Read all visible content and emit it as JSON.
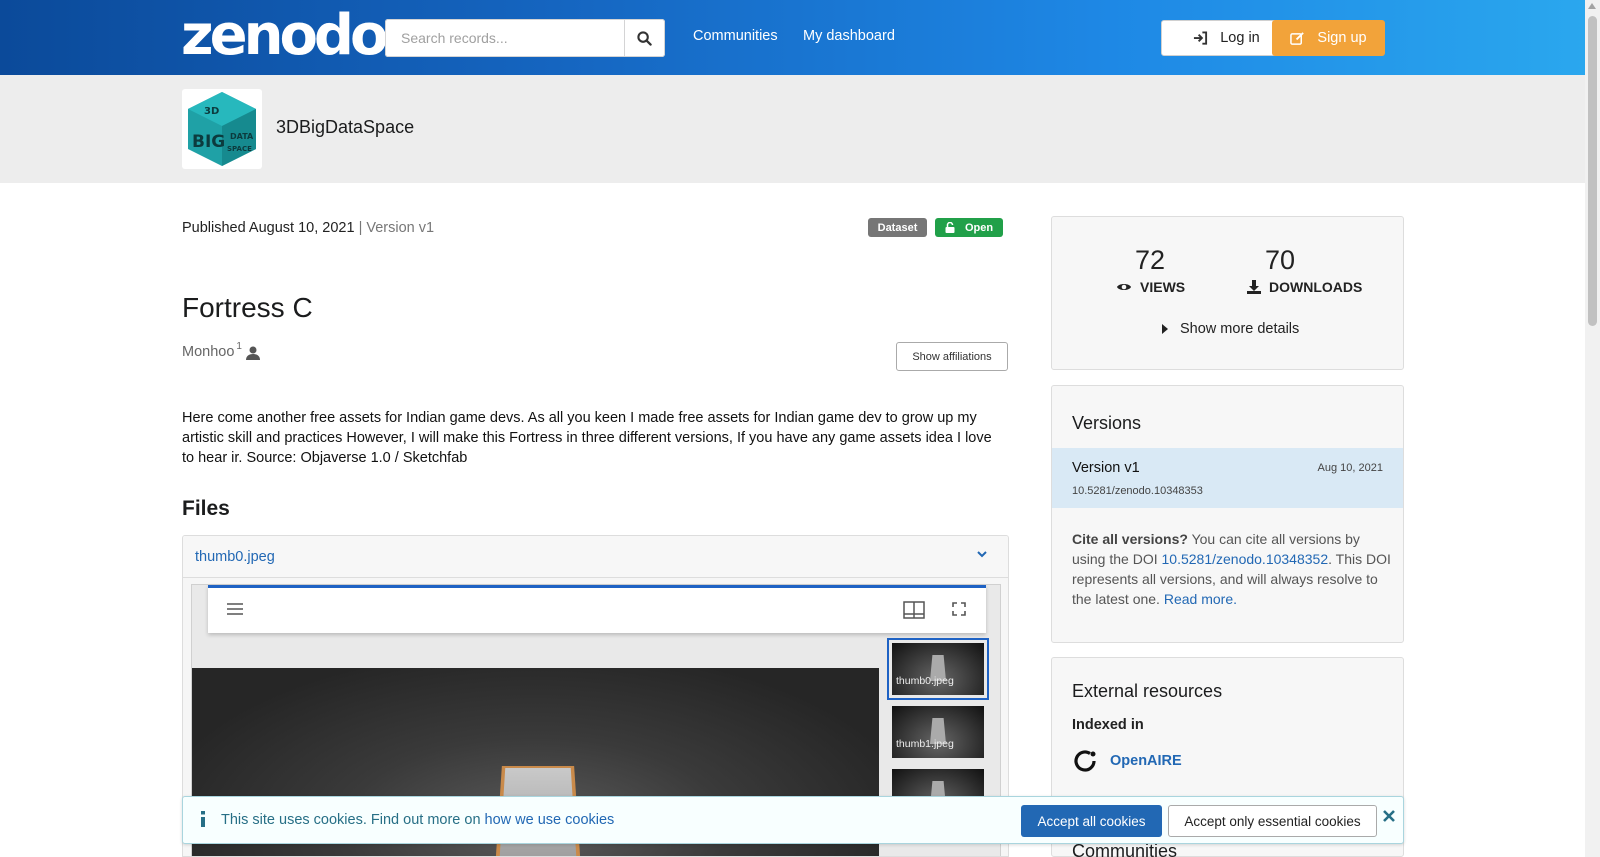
{
  "header": {
    "logo": "zenodo",
    "search_placeholder": "Search records...",
    "nav": [
      "Communities",
      "My dashboard"
    ],
    "login_label": "Log in",
    "signup_label": "Sign up"
  },
  "community": {
    "name": "3DBigDataSpace",
    "logo_text": [
      "3D",
      "BIG",
      "DATA",
      "SPACE"
    ]
  },
  "record": {
    "published": "Published August 10, 2021",
    "version": "| Version v1",
    "badge_type": "Dataset",
    "badge_access": "Open",
    "title": "Fortress C",
    "creator": "Monhoo",
    "creator_sup": "1",
    "affiliations_button": "Show affiliations",
    "description": "Here come another free assets for Indian game devs. As all you keen I made free assets for Indian game dev to grow up my artistic skill and practices However, I will make this Fortress in three different versions, If you have any game assets idea I love to hear ir. Source: Objaverse 1.0 / Sketchfab"
  },
  "files": {
    "heading": "Files",
    "selected": "thumb0.jpeg",
    "thumbnails": [
      "thumb0.jpeg",
      "thumb1.jpeg",
      ""
    ]
  },
  "stats": {
    "views": "72",
    "views_label": "VIEWS",
    "downloads": "70",
    "downloads_label": "DOWNLOADS",
    "more_label": "Show more details"
  },
  "versions": {
    "heading": "Versions",
    "current_name": "Version v1",
    "current_date": "Aug 10, 2021",
    "current_doi": "10.5281/zenodo.10348353",
    "cite_bold": "Cite all versions?",
    "cite_text1": " You can cite all versions by using the DOI ",
    "cite_doi": "10.5281/zenodo.10348352",
    "cite_text2": ". This DOI represents all versions, and will always resolve to the latest one. ",
    "cite_readmore": "Read more."
  },
  "external": {
    "heading": "External resources",
    "indexed_label": "Indexed in",
    "openaire": "OpenAIRE",
    "communities_heading": "Communities"
  },
  "cookie": {
    "text": "This site uses cookies. Find out more on ",
    "link": "how we use cookies",
    "accept_all": "Accept all cookies",
    "accept_essential": "Accept only essential cookies"
  },
  "colors": {
    "header_start": "#0b4a9a",
    "header_end": "#2aa7ee",
    "signup": "#f2a33a",
    "open_badge": "#21a049",
    "link": "#2268b4"
  }
}
